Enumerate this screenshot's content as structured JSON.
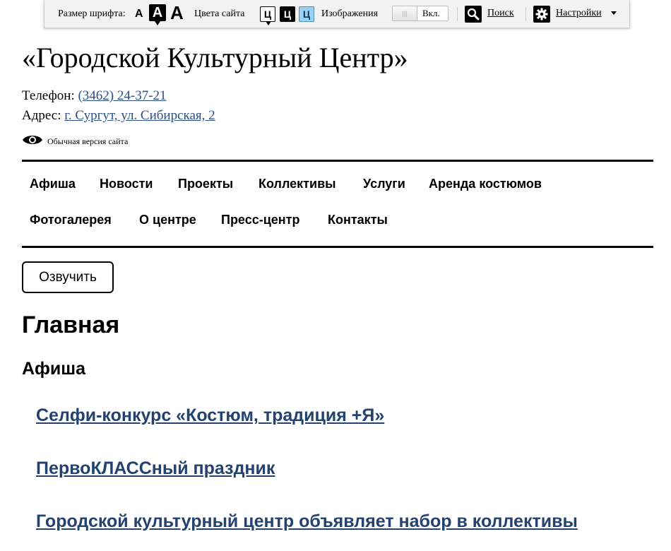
{
  "toolbar": {
    "font_size_label": "Размер шрифта:",
    "font_sizes": [
      "A",
      "A",
      "A"
    ],
    "site_colors_label": "Цвета сайта",
    "color_schemes": [
      "Ц",
      "Ц",
      "Ц"
    ],
    "images_label": "Изображения",
    "images_state": "Вкл.",
    "search_label": "Поиск",
    "settings_label": "Настройки"
  },
  "header": {
    "title": "«Городской Культурный Центр»",
    "phone_label": "Телефон:",
    "phone": "(3462) 24-37-21",
    "address_label": "Адрес:",
    "address": "г. Сургут, ул. Сибирская, 2",
    "normal_version": "Обычная версия сайта"
  },
  "nav": {
    "items": [
      "Афиша",
      "Новости",
      "Проекты",
      "Коллективы",
      "Услуги",
      "Аренда костюмов",
      "Фотогалерея",
      "О центре",
      "Пресс-центр",
      "Контакты"
    ]
  },
  "main": {
    "speak_button": "Озвучить",
    "page_title": "Главная",
    "section_title": "Афиша",
    "news": [
      "Селфи-конкурс «Костюм, традиция +Я»",
      "ПервоКЛАССный праздник",
      "Городской культурный центр объявляет набор в коллективы"
    ]
  }
}
